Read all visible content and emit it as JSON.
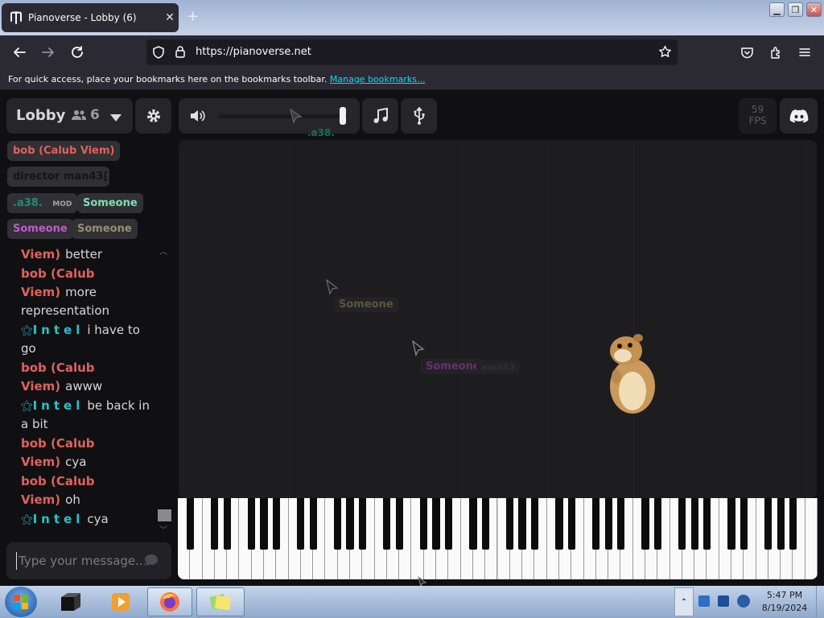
{
  "browser": {
    "tab_title": "Pianoverse - Lobby (6)",
    "url": "https://pianoverse.net",
    "bookmarks_message": "For quick access, place your bookmarks here on the bookmarks toolbar.",
    "bookmarks_link": "Manage bookmarks..."
  },
  "room": {
    "name": "Lobby",
    "user_count": "6"
  },
  "users": [
    {
      "name": "bob (Calub Viem)",
      "color": "#e0615c"
    },
    {
      "name": "director man43[...",
      "color": "#1a1a1a"
    },
    {
      "name": ".a38.",
      "color": "#1d8f7a",
      "tag": "MOD"
    },
    {
      "name": "Someone",
      "color": "#7fe0b0"
    },
    {
      "name": "Someone",
      "color": "#c05cc8"
    },
    {
      "name": "Someone",
      "color": "#9a8e70"
    }
  ],
  "toolbar": {
    "volume_user_label": ".a38.",
    "fps_value": "59",
    "fps_label": "FPS"
  },
  "chat": {
    "messages": [
      {
        "name": "Viem)",
        "text": "better"
      },
      {
        "name": "bob (Calub Viem)",
        "text": "more representation"
      },
      {
        "name": "Intel",
        "text": "i have to go"
      },
      {
        "name": "bob (Calub Viem)",
        "text": "awww"
      },
      {
        "name": "Intel",
        "text": "be back in a bit"
      },
      {
        "name": "bob (Calub Viem)",
        "text": "cya"
      },
      {
        "name": "bob (Calub Viem)",
        "text": "oh"
      },
      {
        "name": "Intel",
        "text": "cya"
      }
    ],
    "placeholder": "Type your message..."
  },
  "canvas": {
    "cursor_labels": [
      {
        "text": "Someone",
        "color": "#5a5640"
      },
      {
        "text": "Someone",
        "color": "#6a2f70"
      },
      {
        "text": "man43",
        "color": "#2f2f33"
      }
    ]
  },
  "taskbar": {
    "time": "5:47 PM",
    "date": "8/19/2024"
  },
  "colors": {
    "accent_red": "#e0615c",
    "accent_teal": "#2bc0c8",
    "panel_bg": "#26262a",
    "app_bg": "#101012"
  }
}
